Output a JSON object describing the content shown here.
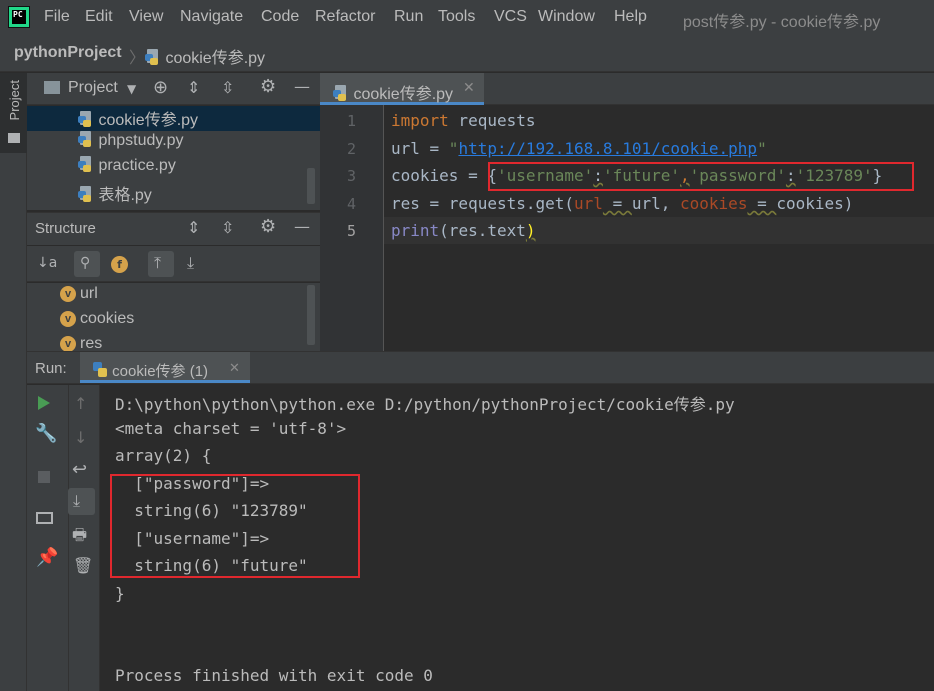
{
  "menubar": {
    "items": [
      "File",
      "Edit",
      "View",
      "Navigate",
      "Code",
      "Refactor",
      "Run",
      "Tools",
      "VCS",
      "Window",
      "Help"
    ],
    "window_title": "post传参.py - cookie传参.py"
  },
  "breadcrumb": {
    "project": "pythonProject",
    "file": "cookie传参.py"
  },
  "side_tab": {
    "label": "Project"
  },
  "project_panel": {
    "title": "Project",
    "files": [
      "cookie传参.py",
      "phpstudy.py",
      "practice.py",
      "表格.py"
    ]
  },
  "structure_panel": {
    "title": "Structure",
    "items": [
      "url",
      "cookies",
      "res"
    ],
    "f_badge": "f",
    "v_badge": "v"
  },
  "editor": {
    "tab_label": "cookie传参.py",
    "line_numbers": [
      "1",
      "2",
      "3",
      "4",
      "5"
    ],
    "lines": {
      "l1_kw": "import",
      "l1_rest": " requests",
      "l2_a": "url = ",
      "l2_q1": "\"",
      "l2_url": "http://192.168.8.101/cookie.php",
      "l2_q2": "\"",
      "l3_a": "cookies = ",
      "l3_b": "{",
      "l3_s1": "'username'",
      "l3_c1": ":",
      "l3_s2": "'future'",
      "l3_c2": ",",
      "l3_s3": "'password'",
      "l3_c3": ":",
      "l3_s4": "'123789'",
      "l3_e": "}",
      "l4_a": "res = requests.get(",
      "l4_p1": "url",
      "l4_eq1": " = ",
      "l4_b": "url, ",
      "l4_p2": "cookies",
      "l4_eq2": " = ",
      "l4_c": "cookies)",
      "l5_kw": "print",
      "l5_a": "(res.text",
      "l5_b": ")"
    }
  },
  "run_panel": {
    "label": "Run:",
    "tab_label": "cookie传参 (1)",
    "output": [
      "D:\\python\\python\\python.exe D:/python/pythonProject/cookie传参.py",
      "<meta charset = 'utf-8'>",
      "array(2) {",
      "  [\"password\"]=>",
      "  string(6) \"123789\"",
      "  [\"username\"]=>",
      "  string(6) \"future\"",
      "}",
      "",
      "Process finished with exit code 0"
    ]
  },
  "colors": {
    "highlight_box": "#e0282e",
    "keyword": "#cc7832",
    "string": "#6a8759",
    "link": "#287bde",
    "selection": "#0d293e"
  }
}
